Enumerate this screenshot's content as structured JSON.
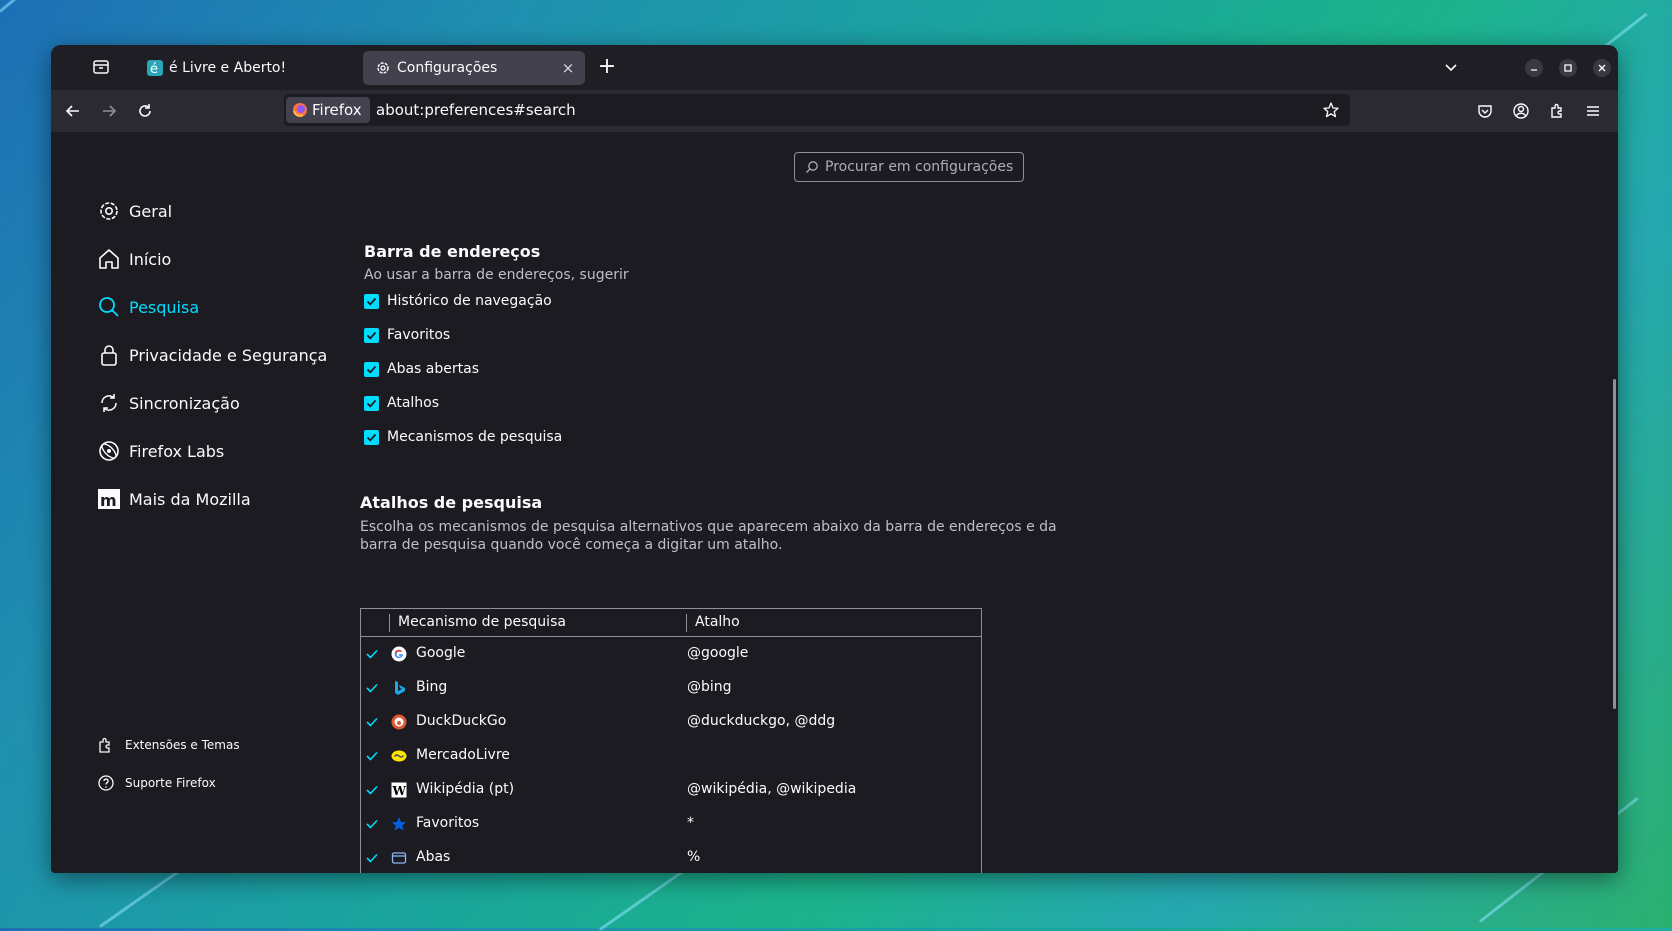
{
  "tabs": [
    {
      "title": "é Livre e Aberto!",
      "close": "×"
    },
    {
      "title": "Configurações",
      "close": "×"
    }
  ],
  "new_tab_label": "+",
  "urlbar": {
    "identity": "Firefox",
    "url": "about:preferences#search"
  },
  "search": {
    "placeholder": "Procurar em configurações"
  },
  "sidebar": {
    "items": [
      {
        "label": "Geral",
        "icon": "gear-icon"
      },
      {
        "label": "Início",
        "icon": "home-icon"
      },
      {
        "label": "Pesquisa",
        "icon": "search-icon",
        "selected": true
      },
      {
        "label": "Privacidade e Segurança",
        "icon": "lock-icon"
      },
      {
        "label": "Sincronização",
        "icon": "sync-icon"
      },
      {
        "label": "Firefox Labs",
        "icon": "labs-icon"
      },
      {
        "label": "Mais da Mozilla",
        "icon": "mozilla-icon"
      }
    ],
    "footer": [
      {
        "label": "Extensões e Temas",
        "icon": "puzzle-icon"
      },
      {
        "label": "Suporte Firefox",
        "icon": "help-icon"
      }
    ]
  },
  "address_bar_section": {
    "title": "Barra de endereços",
    "subtitle": "Ao usar a barra de endereços, sugerir",
    "options": [
      {
        "label": "Histórico de navegação",
        "checked": true
      },
      {
        "label": "Favoritos",
        "checked": true
      },
      {
        "label": "Abas abertas",
        "checked": true
      },
      {
        "label": "Atalhos",
        "checked": true
      },
      {
        "label": "Mecanismos de pesquisa",
        "checked": true
      }
    ]
  },
  "shortcuts_section": {
    "title": "Atalhos de pesquisa",
    "description_line1": "Escolha os mecanismos de pesquisa alternativos que aparecem abaixo da barra de endereços e da",
    "description_line2": "barra de pesquisa quando você começa a digitar um atalho.",
    "columns": [
      "Mecanismo de pesquisa",
      "Atalho"
    ],
    "rows": [
      {
        "name": "Google",
        "keyword": "@google",
        "icon": "google-icon"
      },
      {
        "name": "Bing",
        "keyword": "@bing",
        "icon": "bing-icon"
      },
      {
        "name": "DuckDuckGo",
        "keyword": "@duckduckgo, @ddg",
        "icon": "duckduckgo-icon"
      },
      {
        "name": "MercadoLivre",
        "keyword": "",
        "icon": "mercadolivre-icon"
      },
      {
        "name": "Wikipédia (pt)",
        "keyword": "@wikipédia, @wikipedia",
        "icon": "wikipedia-icon"
      },
      {
        "name": "Favoritos",
        "keyword": "*",
        "icon": "star-icon"
      },
      {
        "name": "Abas",
        "keyword": "%",
        "icon": "tab-icon"
      }
    ]
  },
  "colors": {
    "accent": "#00ddff",
    "background": "#1c1b22",
    "toolbar": "#2b2a33"
  }
}
